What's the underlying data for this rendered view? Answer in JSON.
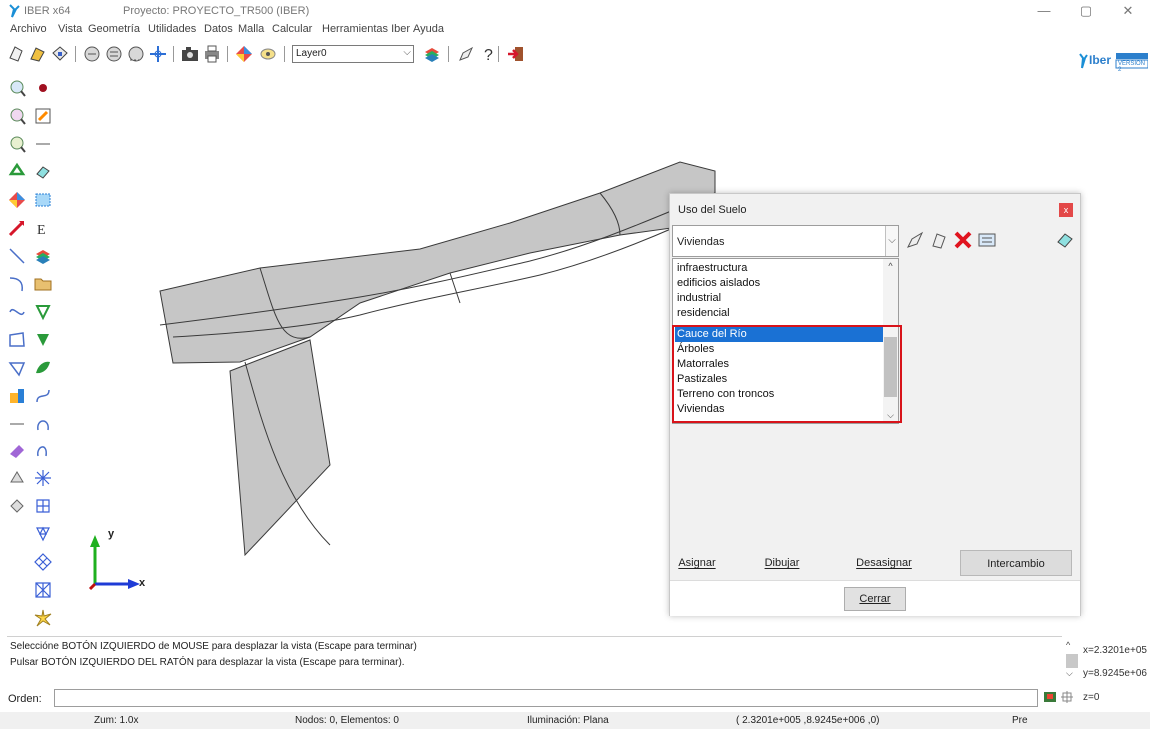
{
  "titlebar": {
    "app_name": "IBER x64",
    "project_title": "Proyecto: PROYECTO_TR500 (IBER)",
    "minimize": "—",
    "maximize": "▢",
    "close": "✕"
  },
  "menu": [
    "Archivo",
    "Vista",
    "Geometría",
    "Utilidades",
    "Datos",
    "Malla",
    "Calcular",
    "Herramientas Iber",
    "Ayuda"
  ],
  "toolbar": {
    "layer_value": "Layer0",
    "logo_text": "Iber",
    "logo_version": "VERSION 2"
  },
  "axes": {
    "y_label": "y",
    "x_label": "x"
  },
  "dialog": {
    "title": "Uso del Suelo",
    "close_label": "x",
    "combo_value": "Viviendas",
    "list_items": [
      "infraestructura",
      "edificios aislados",
      "industrial",
      "residencial",
      "Cauce del Río",
      "Árboles",
      "Matorrales",
      "Pastizales",
      "Terreno con troncos",
      "Viviendas"
    ],
    "selected_item": "Cauce del Río",
    "tabs": [
      "Asignar",
      "Dibujar",
      "Desasignar",
      "Intercambio"
    ],
    "active_tab": "Intercambio",
    "close_button": "Cerrar"
  },
  "log": {
    "line1": "Seleccióne BOTÓN IZQUIERDO de MOUSE para desplazar la vista (Escape para terminar)",
    "line2": "Pulsar BOTÓN IZQUIERDO DEL RATÓN  para desplazar la vista (Escape para terminar).",
    "coord_x": "x=2.3201e+05",
    "coord_y": "y=8.9245e+06",
    "coord_z": "z=0"
  },
  "command": {
    "label": "Orden:",
    "value": ""
  },
  "status": {
    "zoom": "Zum: 1.0x",
    "nodes": "Nodos: 0, Elementos: 0",
    "lighting": "Iluminación: Plana",
    "coords": "( 2.3201e+005 ,8.9245e+006 ,0)",
    "mode": "Pre"
  },
  "colors": {
    "selection": "#1a71d4",
    "highlight_border": "#d8131a",
    "domain_fill": "#c6c6c6",
    "domain_stroke": "#3a3a3a",
    "axis_green": "#1fb01f",
    "axis_blue": "#1e3bd6"
  }
}
